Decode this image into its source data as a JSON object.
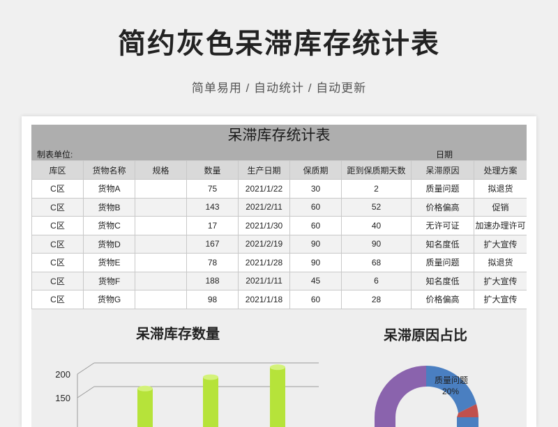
{
  "header": {
    "title": "简约灰色呆滞库存统计表",
    "subtitle": "简单易用 / 自动统计 / 自动更新"
  },
  "sheet": {
    "title": "呆滞库存统计表",
    "unit_label": "制表单位:",
    "date_label": "日期",
    "columns": [
      "库区",
      "货物名称",
      "规格",
      "数量",
      "生产日期",
      "保质期",
      "距到保质期天数",
      "呆滞原因",
      "处理方案"
    ],
    "rows": [
      [
        "C区",
        "货物A",
        "",
        "75",
        "2021/1/22",
        "30",
        "2",
        "质量问题",
        "拟退货"
      ],
      [
        "C区",
        "货物B",
        "",
        "143",
        "2021/2/11",
        "60",
        "52",
        "价格偏高",
        "促销"
      ],
      [
        "C区",
        "货物C",
        "",
        "17",
        "2021/1/30",
        "60",
        "40",
        "无许可证",
        "加速办理许可"
      ],
      [
        "C区",
        "货物D",
        "",
        "167",
        "2021/2/19",
        "90",
        "90",
        "知名度低",
        "扩大宣传"
      ],
      [
        "C区",
        "货物E",
        "",
        "78",
        "2021/1/28",
        "90",
        "68",
        "质量问题",
        "拟退货"
      ],
      [
        "C区",
        "货物F",
        "",
        "188",
        "2021/1/11",
        "45",
        "6",
        "知名度低",
        "扩大宣传"
      ],
      [
        "C区",
        "货物G",
        "",
        "98",
        "2021/1/18",
        "60",
        "28",
        "价格偏高",
        "扩大宣传"
      ]
    ]
  },
  "charts": {
    "left_title": "呆滞库存数量",
    "right_title": "呆滞原因占比",
    "bar_axis_ticks": [
      "200",
      "150"
    ],
    "bar_values": [
      143,
      167,
      188
    ],
    "pie_label_name": "质量问题",
    "pie_label_pct": "20%",
    "colors": {
      "bar": "#b6e33a",
      "pie_blue": "#4a7fc1",
      "pie_purple": "#8a63ad",
      "pie_red": "#c0504d"
    }
  }
}
